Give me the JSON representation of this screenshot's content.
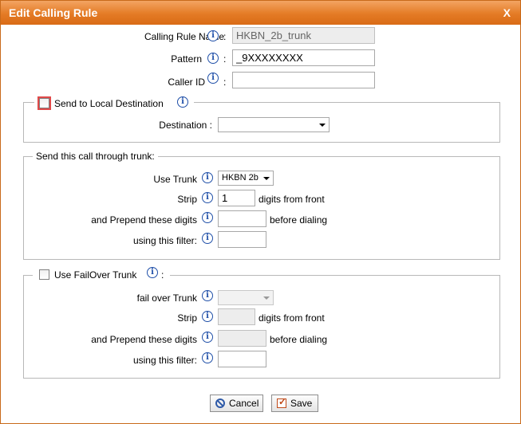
{
  "dialog": {
    "title": "Edit Calling Rule",
    "close_label": "X"
  },
  "general": {
    "calling_rule_name_label": "Calling Rule Name",
    "calling_rule_name_value": "HKBN_2b_trunk",
    "pattern_label": "Pattern",
    "pattern_value": "_9XXXXXXXX",
    "caller_id_label": "Caller ID",
    "caller_id_value": ""
  },
  "local_destination": {
    "checkbox_label": "Send to Local Destination",
    "checked": false,
    "destination_label": "Destination :",
    "destination_value": ""
  },
  "trunk": {
    "legend": "Send this call through trunk:",
    "use_trunk_label": "Use Trunk",
    "use_trunk_value": "HKBN 2b",
    "strip_label": "Strip",
    "strip_value": "1",
    "strip_suffix": "digits from front",
    "prepend_label": "and Prepend these digits",
    "prepend_value": "",
    "prepend_suffix": "before dialing",
    "filter_label": "using this filter:",
    "filter_value": ""
  },
  "failover": {
    "checkbox_label": "Use FailOver Trunk",
    "checked": false,
    "colon": ":",
    "fail_over_trunk_label": "fail over Trunk",
    "fail_over_trunk_value": "",
    "strip_label": "Strip",
    "strip_value": "",
    "strip_suffix": "digits from front",
    "prepend_label": "and Prepend these digits",
    "prepend_value": "",
    "prepend_suffix": "before dialing",
    "filter_label": "using this filter:",
    "filter_value": ""
  },
  "buttons": {
    "cancel_label": "Cancel",
    "save_label": "Save"
  },
  "icons": {
    "info": "i",
    "colon": ":"
  },
  "colors": {
    "titlebar": "#e47b25",
    "info_icon": "#1f4fa8",
    "focus_outline": "#e04a4a"
  }
}
